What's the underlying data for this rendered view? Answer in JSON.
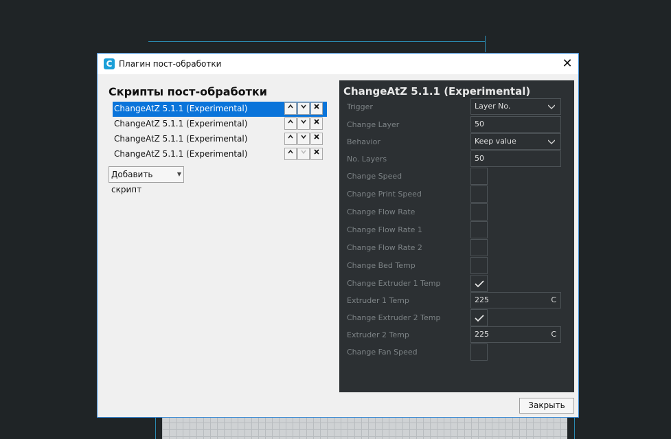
{
  "window": {
    "title": "Плагин пост-обработки",
    "app_icon": "cura-icon",
    "close_glyph": "✕"
  },
  "scripts": {
    "header": "Скрипты пост-обработки",
    "items": [
      {
        "label": "ChangeAtZ 5.1.1 (Experimental)",
        "selected": true
      },
      {
        "label": "ChangeAtZ 5.1.1 (Experimental)",
        "selected": false
      },
      {
        "label": "ChangeAtZ 5.1.1 (Experimental)",
        "selected": false
      },
      {
        "label": "ChangeAtZ 5.1.1 (Experimental)",
        "selected": false
      }
    ],
    "add_button": "Добавить скрипт"
  },
  "panel": {
    "title": "ChangeAtZ 5.1.1 (Experimental)",
    "settings": {
      "trigger": {
        "label": "Trigger",
        "value": "Layer No."
      },
      "change_layer": {
        "label": "Change Layer",
        "value": "50"
      },
      "behavior": {
        "label": "Behavior",
        "value": "Keep value"
      },
      "no_layers": {
        "label": "No. Layers",
        "value": "50"
      },
      "change_speed": {
        "label": "Change Speed",
        "checked": false
      },
      "change_print_speed": {
        "label": "Change Print Speed",
        "checked": false
      },
      "change_flow_rate": {
        "label": "Change Flow Rate",
        "checked": false
      },
      "change_flow_rate_1": {
        "label": "Change Flow Rate 1",
        "checked": false
      },
      "change_flow_rate_2": {
        "label": "Change Flow Rate 2",
        "checked": false
      },
      "change_bed_temp": {
        "label": "Change Bed Temp",
        "checked": false
      },
      "change_extruder_1_temp": {
        "label": "Change Extruder 1 Temp",
        "checked": true
      },
      "extruder_1_temp": {
        "label": "Extruder 1 Temp",
        "value": "225",
        "unit": "C"
      },
      "change_extruder_2_temp": {
        "label": "Change Extruder 2 Temp",
        "checked": true
      },
      "extruder_2_temp": {
        "label": "Extruder 2 Temp",
        "value": "225",
        "unit": "C"
      },
      "change_fan_speed": {
        "label": "Change Fan Speed",
        "checked": false
      }
    }
  },
  "footer": {
    "close_button": "Закрыть"
  },
  "colors": {
    "selection": "#0a74da",
    "panel_bg": "#2c3033",
    "viewport_bg": "#1f2426",
    "build_volume": "#2a8ab0"
  }
}
